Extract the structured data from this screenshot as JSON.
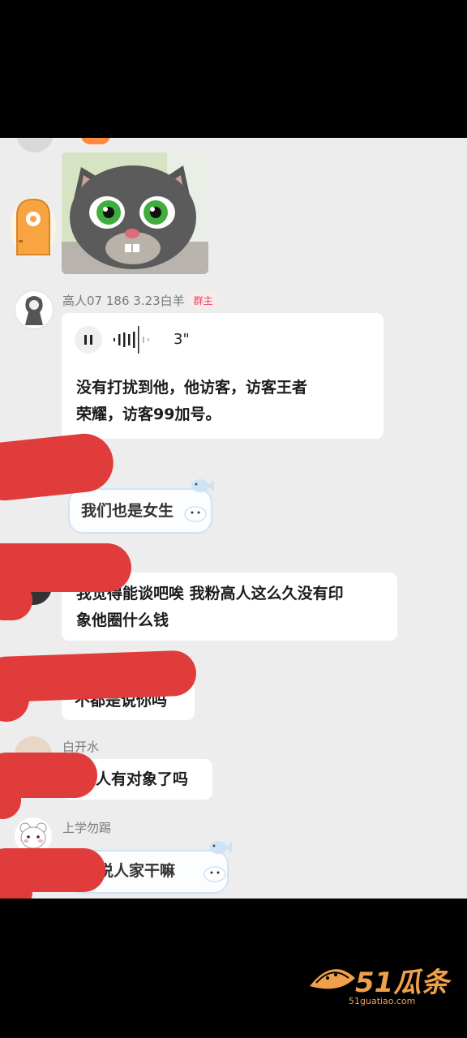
{
  "messages": [
    {
      "sender": "高人07 186 3.23白羊",
      "role_badge": "群主",
      "voice": {
        "duration": "3\""
      },
      "text": [
        "没有打扰到他，他访客，访客王者",
        "荣耀，访客99加号。"
      ]
    },
    {
      "text": "我们也是女生"
    },
    {
      "text": [
        "我觉得能谈吧唉 我粉高人这么久没有印",
        "象他圈什么钱"
      ]
    },
    {
      "text": "不都是说你吗"
    },
    {
      "sender": "白开水",
      "text": "人有对象了吗"
    },
    {
      "sender": "上学勿踢",
      "text": "们说人家干嘛"
    }
  ],
  "watermark": {
    "logo_text": "51瓜条",
    "url": "51guatiao.com"
  },
  "colors": {
    "chat_bg": "#ededed",
    "redaction": "#e03c3c",
    "badge": "#e0495f",
    "watermark": "#f0a04b"
  }
}
